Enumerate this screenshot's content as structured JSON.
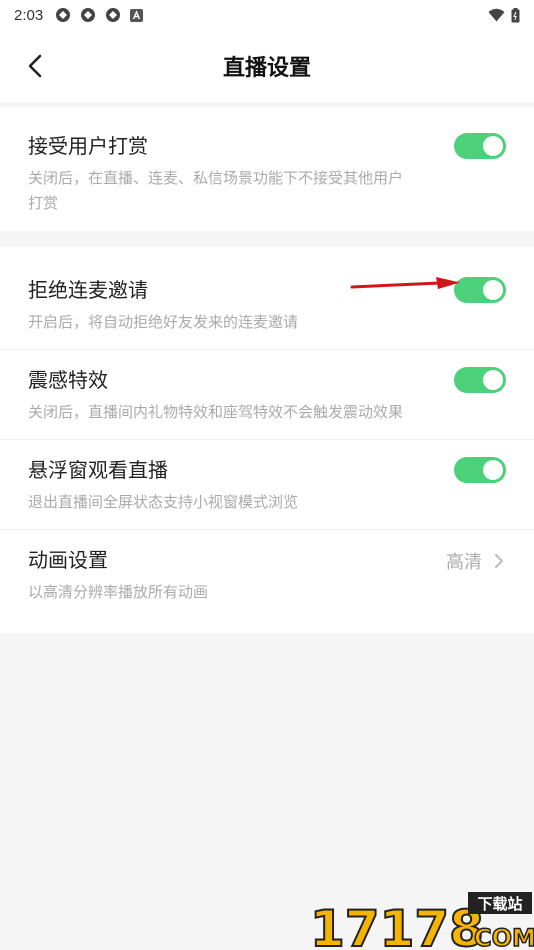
{
  "status_bar": {
    "time": "2:03"
  },
  "nav": {
    "title": "直播设置"
  },
  "settings": {
    "reward": {
      "title": "接受用户打赏",
      "desc": "关闭后，在直播、连麦、私信场景功能下不接受其他用户打赏",
      "enabled": true
    },
    "refuse_invite": {
      "title": "拒绝连麦邀请",
      "desc": "开启后，将自动拒绝好友发来的连麦邀请",
      "enabled": true
    },
    "vibration": {
      "title": "震感特效",
      "desc": "关闭后，直播间内礼物特效和座驾特效不会触发震动效果",
      "enabled": true
    },
    "floating_window": {
      "title": "悬浮窗观看直播",
      "desc": "退出直播间全屏状态支持小视窗模式浏览",
      "enabled": true
    },
    "animation": {
      "title": "动画设置",
      "value": "高清",
      "desc": "以高清分辨率播放所有动画"
    }
  },
  "watermark": {
    "number": "17178",
    "domain": "COM",
    "tag": "下载站"
  },
  "colors": {
    "toggle_on": "#4cd17a",
    "annotation_arrow": "#d4141a"
  }
}
